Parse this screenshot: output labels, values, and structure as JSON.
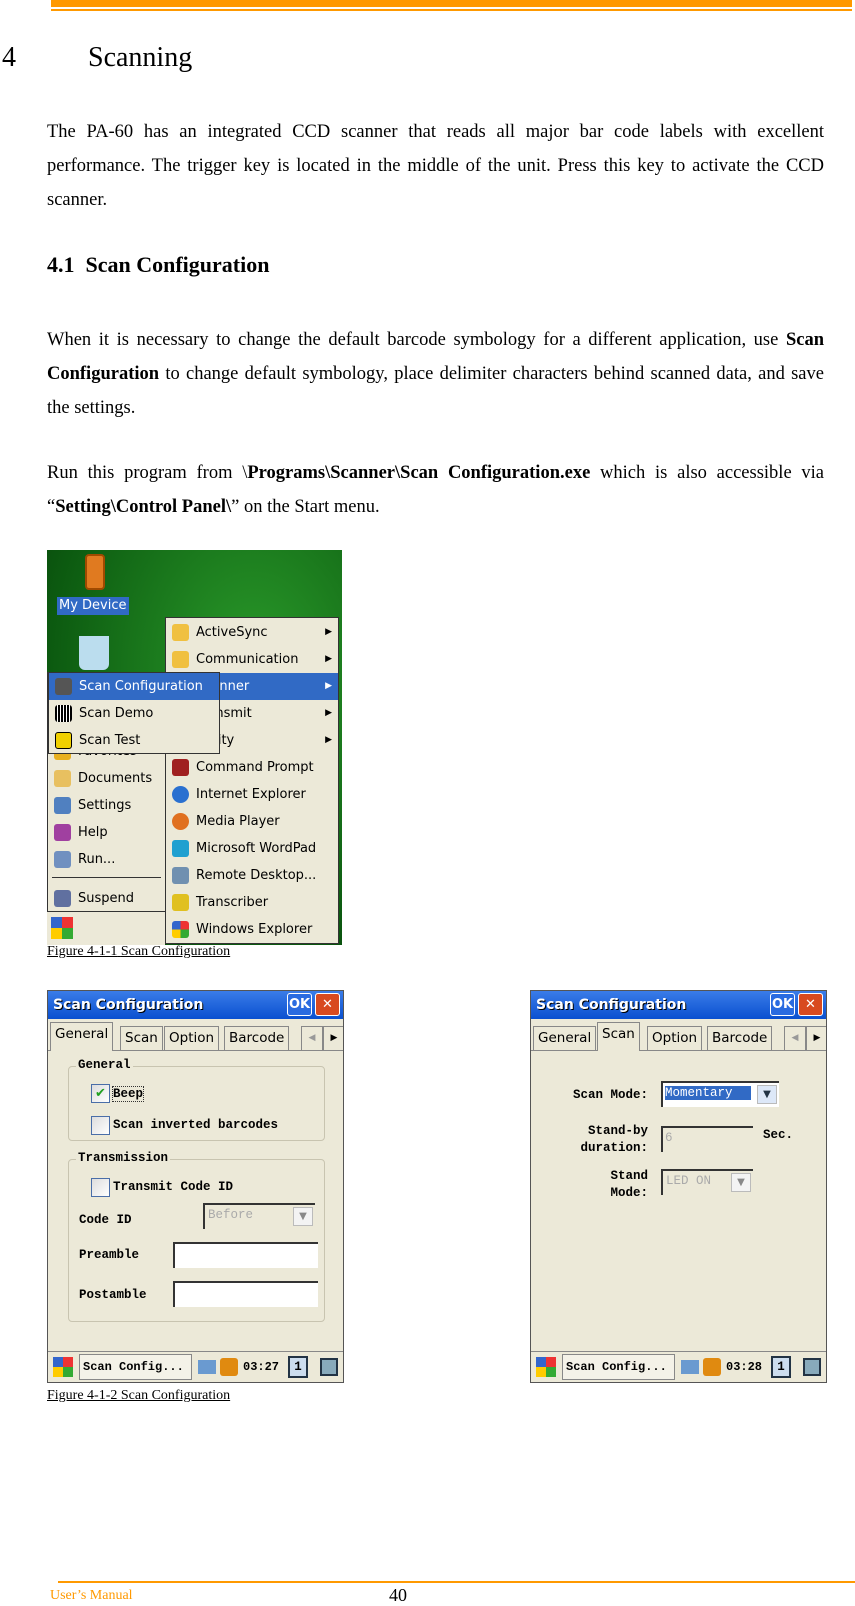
{
  "header": {
    "accent": "#ff9900"
  },
  "chapter": {
    "number": "4",
    "title": "Scanning"
  },
  "intro": "The PA-60 has an integrated CCD scanner that reads all major bar code labels with excellent performance. The trigger key is located in the middle of the unit. Press this key to activate the CCD scanner.",
  "section": {
    "number": "4.1",
    "title": "Scan Configuration"
  },
  "para1": {
    "a": "When it is necessary to change the default barcode symbology for a different application, use ",
    "b": "Scan Configuration",
    "c": " to change default symbology, place delimiter characters behind scanned data, and save the settings."
  },
  "para2": {
    "a": "Run this program from \\",
    "b": "Programs\\Scanner\\Scan Configuration.exe",
    "c": " which is also accessible via “",
    "d": "Setting\\Control Panel\\",
    "e": "” on the Start menu."
  },
  "fig1": {
    "desktop": {
      "my_device": "My Device"
    },
    "start_menu": [
      "Favorites",
      "Documents",
      "Settings",
      "Help",
      "Run...",
      "Suspend"
    ],
    "programs_menu": [
      "ActiveSync",
      "Communication",
      "Scanner",
      "Transmit",
      "Utility",
      "Command Prompt",
      "Internet Explorer",
      "Media Player",
      "Microsoft WordPad",
      "Remote Desktop...",
      "Transcriber",
      "Windows Explorer"
    ],
    "scanner_menu": [
      "Scan Configuration",
      "Scan Demo",
      "Scan Test"
    ],
    "caption_a": "Figure 4-1-1",
    "caption_b": "Scan Configuration"
  },
  "fig2": {
    "title": "Scan Configuration",
    "ok": "OK",
    "close": "✕",
    "tabs": [
      "General",
      "Scan",
      "Option",
      "Barcode"
    ],
    "general": {
      "group1": "General",
      "beep": "Beep",
      "beep_checked": true,
      "inverted": "Scan inverted barcodes",
      "inverted_checked": false,
      "group2": "Transmission",
      "transmit": "Transmit Code ID",
      "transmit_checked": false,
      "code_id_label": "Code ID",
      "code_id_value": "Before",
      "preamble_label": "Preamble",
      "preamble_value": "",
      "postamble_label": "Postamble",
      "postamble_value": ""
    },
    "scan": {
      "scan_mode_label": "Scan Mode:",
      "scan_mode_value": "Momentary",
      "standby_label1": "Stand-by",
      "standby_label2": "duration:",
      "standby_value": "6",
      "standby_unit": "Sec.",
      "stand_label1": "Stand",
      "stand_label2": "Mode:",
      "stand_value": "LED ON"
    },
    "taskbar": {
      "task": "Scan Config...",
      "time_left": "03:27",
      "time_right": "03:28",
      "desk": "1"
    },
    "caption": "Figure 4-1-2 Scan Configuration"
  },
  "footer": {
    "manual": "User’s Manual",
    "page": "40"
  }
}
